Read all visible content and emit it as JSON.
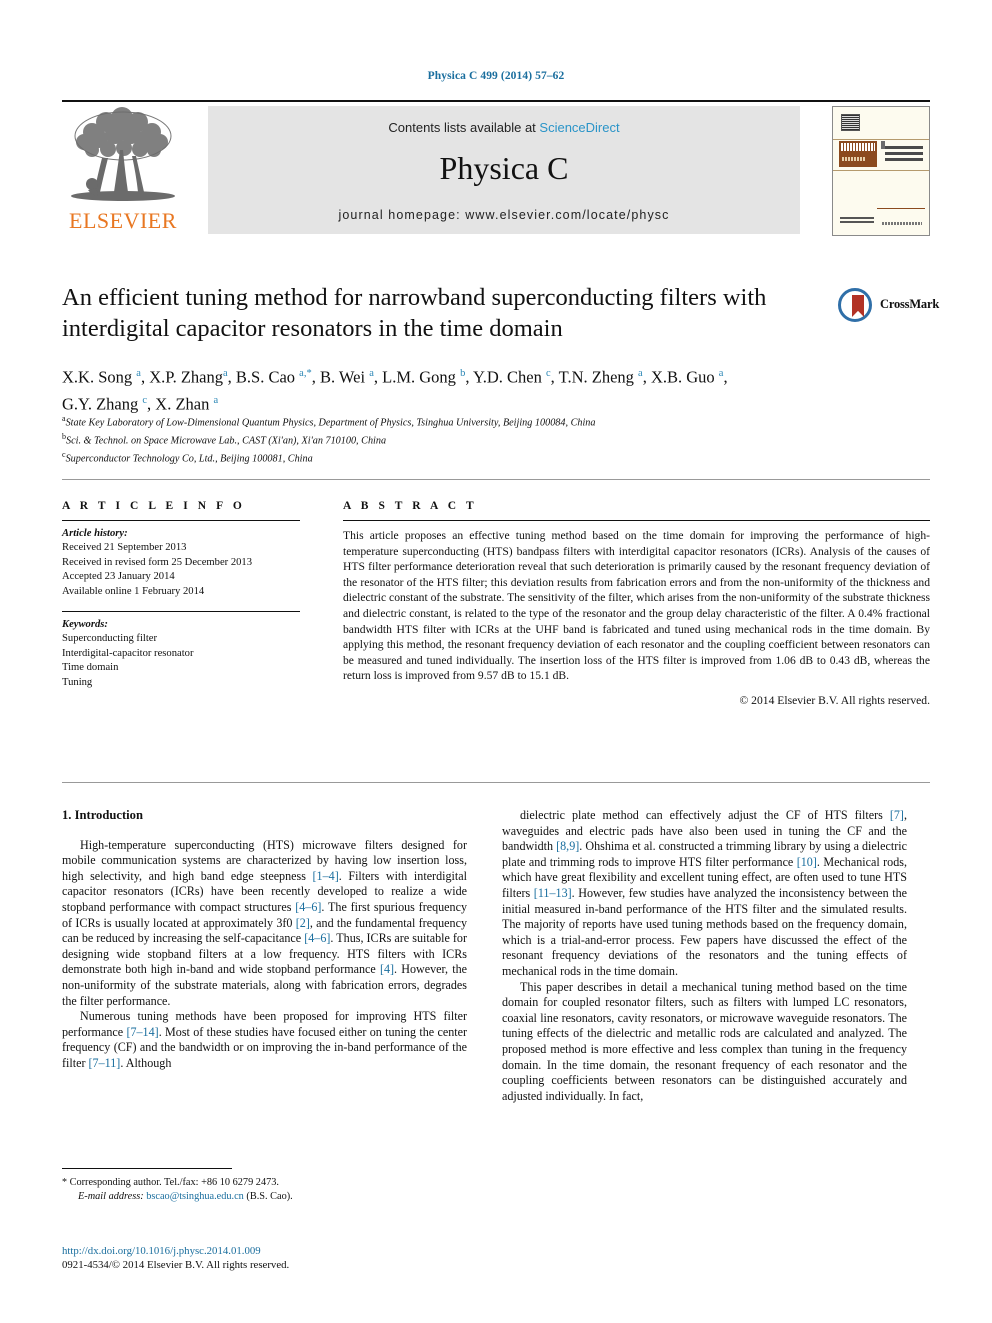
{
  "running_head": "Physica C 499 (2014) 57–62",
  "masthead": {
    "elsevier_wordmark": "ELSEVIER",
    "contents_prefix": "Contents lists available at ",
    "sciencedirect": "ScienceDirect",
    "journal_title": "Physica C",
    "homepage": "journal homepage: www.elsevier.com/locate/physc"
  },
  "crossmark": {
    "label": "CrossMark"
  },
  "article": {
    "title": "An efficient tuning method for narrowband superconducting filters with interdigital capacitor resonators in the time domain",
    "authors": "X.K. Song a, X.P. Zhang a, B.S. Cao a,*, B. Wei a, L.M. Gong b, Y.D. Chen c, T.N. Zheng a, X.B. Guo a, G.Y. Zhang c, X. Zhan a",
    "affiliations": [
      "a State Key Laboratory of Low-Dimensional Quantum Physics, Department of Physics, Tsinghua University, Beijing 100084, China",
      "b Sci. & Technol. on Space Microwave Lab., CAST (Xi'an), Xi'an 710100, China",
      "c Superconductor Technology Co, Ltd., Beijing 100081, China"
    ]
  },
  "info": {
    "heading": "A R T I C L E   I N F O",
    "history_label": "Article history:",
    "history": [
      "Received 21 September 2013",
      "Received in revised form 25 December 2013",
      "Accepted 23 January 2014",
      "Available online 1 February 2014"
    ],
    "keywords_label": "Keywords:",
    "keywords": [
      "Superconducting filter",
      "Interdigital-capacitor resonator",
      "Time domain",
      "Tuning"
    ]
  },
  "abstract": {
    "heading": "A B S T R A C T",
    "text": "This article proposes an effective tuning method based on the time domain for improving the performance of high-temperature superconducting (HTS) bandpass filters with interdigital capacitor resonators (ICRs). Analysis of the causes of HTS filter performance deterioration reveal that such deterioration is primarily caused by the resonant frequency deviation of the resonator of the HTS filter; this deviation results from fabrication errors and from the non-uniformity of the thickness and dielectric constant of the substrate. The sensitivity of the filter, which arises from the non-uniformity of the substrate thickness and dielectric constant, is related to the type of the resonator and the group delay characteristic of the filter. A 0.4% fractional bandwidth HTS filter with ICRs at the UHF band is fabricated and tuned using mechanical rods in the time domain. By applying this method, the resonant frequency deviation of each resonator and the coupling coefficient between resonators can be measured and tuned individually. The insertion loss of the HTS filter is improved from 1.06 dB to 0.43 dB, whereas the return loss is improved from 9.57 dB to 15.1 dB.",
    "copyright": "© 2014 Elsevier B.V. All rights reserved."
  },
  "body": {
    "section_title": "1. Introduction",
    "left_paragraphs": [
      "High-temperature superconducting (HTS) microwave filters designed for mobile communication systems are characterized by having low insertion loss, high selectivity, and high band edge steepness [1–4]. Filters with interdigital capacitor resonators (ICRs) have been recently developed to realize a wide stopband performance with compact structures [4–6]. The first spurious frequency of ICRs is usually located at approximately 3f0 [2], and the fundamental frequency can be reduced by increasing the self-capacitance [4–6]. Thus, ICRs are suitable for designing wide stopband filters at a low frequency. HTS filters with ICRs demonstrate both high in-band and wide stopband performance [4]. However, the non-uniformity of the substrate materials, along with fabrication errors, degrades the filter performance.",
      "Numerous tuning methods have been proposed for improving HTS filter performance [7–14]. Most of these studies have focused either on tuning the center frequency (CF) and the bandwidth or on improving the in-band performance of the filter [7–11]. Although"
    ],
    "right_paragraphs": [
      "dielectric plate method can effectively adjust the CF of HTS filters [7], waveguides and electric pads have also been used in tuning the CF and the bandwidth [8,9]. Ohshima et al. constructed a trimming library by using a dielectric plate and trimming rods to improve HTS filter performance [10]. Mechanical rods, which have great flexibility and excellent tuning effect, are often used to tune HTS filters [11–13]. However, few studies have analyzed the inconsistency between the initial measured in-band performance of the HTS filter and the simulated results. The majority of reports have used tuning methods based on the frequency domain, which is a trial-and-error process. Few papers have discussed the effect of the resonant frequency deviations of the resonators and the tuning effects of mechanical rods in the time domain.",
      "This paper describes in detail a mechanical tuning method based on the time domain for coupled resonator filters, such as filters with lumped LC resonators, coaxial line resonators, cavity resonators, or microwave waveguide resonators. The tuning effects of the dielectric and metallic rods are calculated and analyzed. The proposed method is more effective and less complex than tuning in the frequency domain. In the time domain, the resonant frequency of each resonator and the coupling coefficients between resonators can be distinguished accurately and adjusted individually. In fact,"
    ]
  },
  "footnote": {
    "star": "*",
    "corresponding": "Corresponding author. Tel./fax: +86 10 6279 2473.",
    "email_label": "E-mail address:",
    "email": "bscao@tsinghua.edu.cn",
    "email_owner": "(B.S. Cao)."
  },
  "doi": {
    "url": "http://dx.doi.org/10.1016/j.physc.2014.01.009",
    "issn_line": "0921-4534/© 2014 Elsevier B.V. All rights reserved."
  },
  "colors": {
    "link_blue": "#1a6e9e",
    "sciencedirect_blue": "#2a94c8",
    "elsevier_orange": "#e87722",
    "crossmark_red": "#b23225",
    "crossmark_blue": "#2f6fa8",
    "band_gray": "#e4e4e4"
  }
}
